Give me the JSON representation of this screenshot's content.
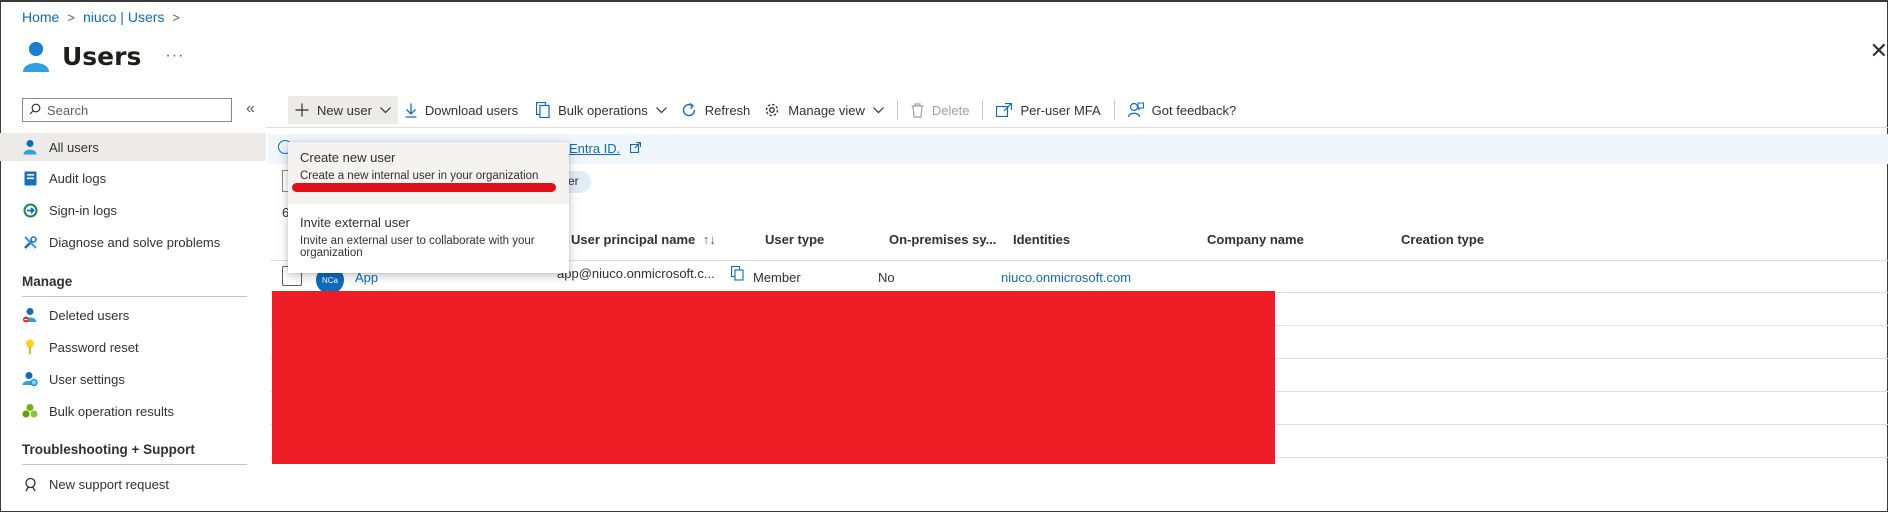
{
  "breadcrumb": {
    "home": "Home",
    "parent": "niuco | Users",
    "sep": ">"
  },
  "page": {
    "title": "Users",
    "more": "···",
    "close": "✕"
  },
  "sidebar": {
    "search_placeholder": "Search",
    "collapse": "«",
    "items": [
      {
        "label": "All users",
        "icon": "user-icon"
      },
      {
        "label": "Audit logs",
        "icon": "audit-log-icon"
      },
      {
        "label": "Sign-in logs",
        "icon": "sign-in-icon"
      },
      {
        "label": "Diagnose and solve problems",
        "icon": "wrench-icon"
      }
    ],
    "manage_heading": "Manage",
    "manage_items": [
      {
        "label": "Deleted users",
        "icon": "deleted-user-icon"
      },
      {
        "label": "Password reset",
        "icon": "key-icon"
      },
      {
        "label": "User settings",
        "icon": "user-settings-icon"
      },
      {
        "label": "Bulk operation results",
        "icon": "bulk-results-icon"
      }
    ],
    "support_heading": "Troubleshooting + Support",
    "support_items": [
      {
        "label": "New support request",
        "icon": "support-icon"
      }
    ]
  },
  "toolbar": {
    "new_user": "New user",
    "download_users": "Download users",
    "bulk_operations": "Bulk operations",
    "refresh": "Refresh",
    "manage_view": "Manage view",
    "delete": "Delete",
    "per_user_mfa": "Per-user MFA",
    "got_feedback": "Got feedback?"
  },
  "banner": {
    "link_text": "Entra ID."
  },
  "filter_pill": "er",
  "count_fragment": "6",
  "dropdown": {
    "items": [
      {
        "title": "Create new user",
        "description": "Create a new internal user in your organization"
      },
      {
        "title": "Invite external user",
        "description": "Invite an external user to collaborate with your organization"
      }
    ]
  },
  "table": {
    "headers": {
      "upn": "User principal name",
      "sort_icon": "↑↓",
      "user_type": "User type",
      "on_prem": "On-premises sy...",
      "identities": "Identities",
      "company": "Company name",
      "creation": "Creation type"
    },
    "rows": [
      {
        "avatar": "NCa",
        "name": "App",
        "upn": "app@niuco.onmicrosoft.c...",
        "user_type": "Member",
        "on_prem": "No",
        "identities": "niuco.onmicrosoft.com"
      }
    ]
  },
  "colors": {
    "accent": "#0f6cbd",
    "redaction": "#ee1c25",
    "highlight_mark": "#e3101a"
  }
}
